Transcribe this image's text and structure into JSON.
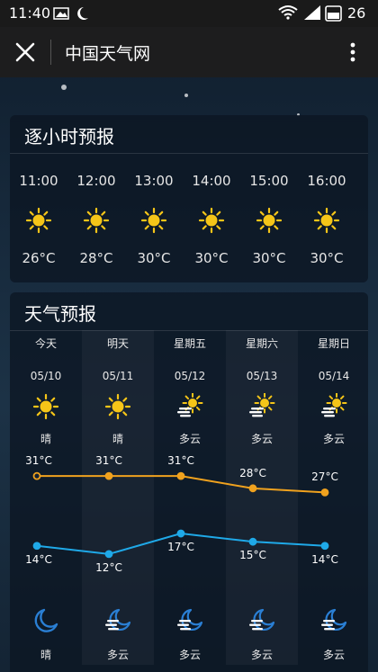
{
  "status_bar": {
    "time": "11:40",
    "battery": "26"
  },
  "title_bar": {
    "title": "中国天气网"
  },
  "hourly": {
    "title": "逐小时预报",
    "items": [
      {
        "time": "11:00",
        "temp": "26°C",
        "icon": "sun-icon"
      },
      {
        "time": "12:00",
        "temp": "28°C",
        "icon": "sun-icon"
      },
      {
        "time": "13:00",
        "temp": "30°C",
        "icon": "sun-icon"
      },
      {
        "time": "14:00",
        "temp": "30°C",
        "icon": "sun-icon"
      },
      {
        "time": "15:00",
        "temp": "30°C",
        "icon": "sun-icon"
      },
      {
        "time": "16:00",
        "temp": "30°C",
        "icon": "sun-icon"
      }
    ]
  },
  "forecast": {
    "title": "天气预报",
    "days": [
      {
        "name": "今天",
        "date": "05/10",
        "day_icon": "sun-icon",
        "day_cond": "晴",
        "high": "31°C",
        "low": "14°C",
        "night_icon": "moon-icon",
        "night_cond": "晴"
      },
      {
        "name": "明天",
        "date": "05/11",
        "day_icon": "sun-icon",
        "day_cond": "晴",
        "high": "31°C",
        "low": "12°C",
        "night_icon": "moon-cloud-icon",
        "night_cond": "多云"
      },
      {
        "name": "星期五",
        "date": "05/12",
        "day_icon": "sun-cloud-icon",
        "day_cond": "多云",
        "high": "31°C",
        "low": "17°C",
        "night_icon": "moon-cloud-icon",
        "night_cond": "多云"
      },
      {
        "name": "星期六",
        "date": "05/13",
        "day_icon": "sun-cloud-icon",
        "day_cond": "多云",
        "high": "28°C",
        "low": "15°C",
        "night_icon": "moon-cloud-icon",
        "night_cond": "多云"
      },
      {
        "name": "星期日",
        "date": "05/14",
        "day_icon": "sun-cloud-icon",
        "day_cond": "多云",
        "high": "27°C",
        "low": "14°C",
        "night_icon": "moon-cloud-icon",
        "night_cond": "多云"
      }
    ]
  },
  "chart_data": {
    "type": "line",
    "categories": [
      "今天",
      "明天",
      "星期五",
      "星期六",
      "星期日"
    ],
    "series": [
      {
        "values": [
          31,
          31,
          31,
          28,
          27
        ],
        "color": "#f0a21e"
      },
      {
        "values": [
          14,
          12,
          17,
          15,
          14
        ],
        "color": "#1fa9e8"
      }
    ],
    "labels": {
      "high": [
        "31°C",
        "31°C",
        "31°C",
        "28°C",
        "27°C"
      ],
      "low": [
        "14°C",
        "12°C",
        "17°C",
        "15°C",
        "14°C"
      ]
    }
  },
  "colors": {
    "sun": "#f5c518",
    "moon": "#2a7fd4",
    "high_line": "#f0a21e",
    "low_line": "#1fa9e8"
  }
}
